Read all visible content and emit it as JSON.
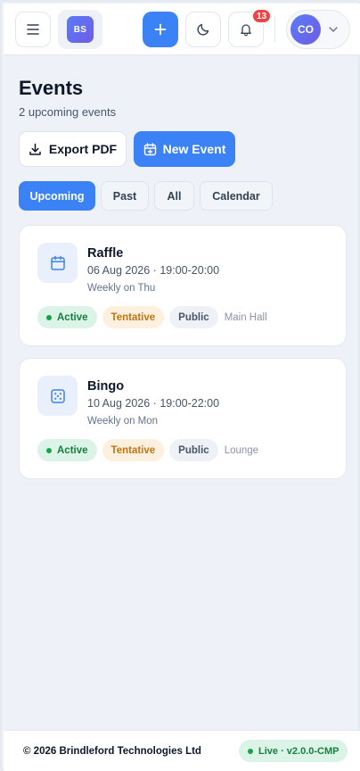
{
  "header": {
    "brand_initials": "BS",
    "notification_count": "13",
    "user_initials": "CO",
    "icons": [
      "menu-icon",
      "plus-icon",
      "moon-icon",
      "bell-icon",
      "chevron-down-icon"
    ]
  },
  "page": {
    "title": "Events",
    "subtitle": "2 upcoming events",
    "export_label": "Export PDF",
    "new_event_label": "New Event"
  },
  "tabs": [
    {
      "label": "Upcoming",
      "active": true
    },
    {
      "label": "Past",
      "active": false
    },
    {
      "label": "All",
      "active": false
    },
    {
      "label": "Calendar",
      "active": false
    }
  ],
  "events": [
    {
      "icon": "calendar-icon",
      "title": "Raffle",
      "when": "06 Aug 2026 · 19:00-20:00",
      "repeat": "Weekly on Thu",
      "status": "Active",
      "confirmation": "Tentative",
      "visibility": "Public",
      "location": "Main Hall"
    },
    {
      "icon": "dice-icon",
      "title": "Bingo",
      "when": "10 Aug 2026 · 19:00-22:00",
      "repeat": "Weekly on Mon",
      "status": "Active",
      "confirmation": "Tentative",
      "visibility": "Public",
      "location": "Lounge"
    }
  ],
  "footer": {
    "copyright": "© 2026 Brindleford Technologies Ltd",
    "status": "Live · v2.0.0-CMP"
  },
  "colors": {
    "accent": "#3b82f6",
    "success": "#16a34a",
    "warning": "#c27412",
    "danger": "#ef4444"
  }
}
